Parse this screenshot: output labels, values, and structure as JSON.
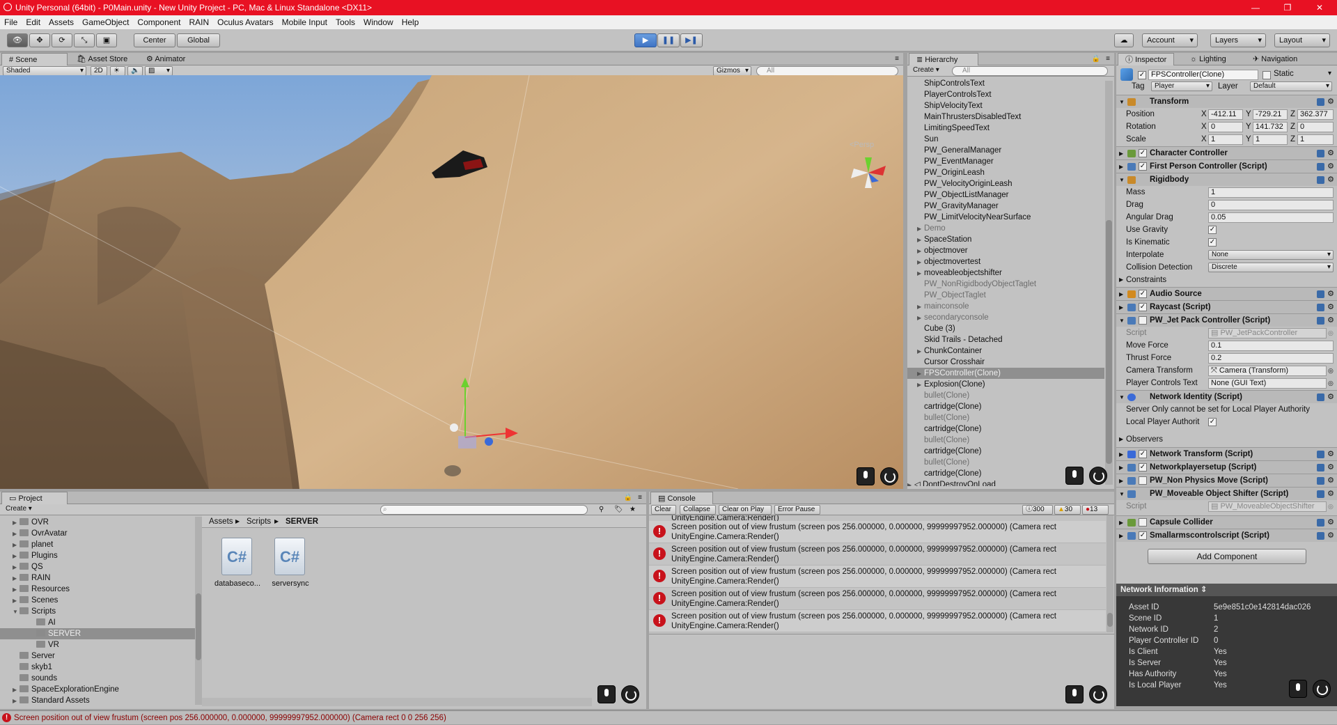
{
  "window": {
    "title": "Unity Personal (64bit) - P0Main.unity - New Unity Project - PC, Mac & Linux Standalone <DX11>"
  },
  "menu": [
    "File",
    "Edit",
    "Assets",
    "GameObject",
    "Component",
    "RAIN",
    "Oculus Avatars",
    "Mobile Input",
    "Tools",
    "Window",
    "Help"
  ],
  "toolbar": {
    "center": "Center",
    "global": "Global",
    "account": "Account",
    "layers": "Layers",
    "layout": "Layout"
  },
  "scene": {
    "tabs": [
      "Scene",
      "Asset Store",
      "Animator"
    ],
    "shading": "Shaded",
    "mode2d": "2D",
    "gizmos": "Gizmos",
    "search_placeholder": "All",
    "persp": "<Persp"
  },
  "hierarchy": {
    "tab": "Hierarchy",
    "create": "Create",
    "search_placeholder": "All",
    "items": [
      {
        "label": "ShipControlsText",
        "arrow": "",
        "style": "normal"
      },
      {
        "label": "PlayerControlsText",
        "arrow": "",
        "style": "normal"
      },
      {
        "label": "ShipVelocityText",
        "arrow": "",
        "style": "normal"
      },
      {
        "label": "MainThrustersDisabledText",
        "arrow": "",
        "style": "normal"
      },
      {
        "label": "LimitingSpeedText",
        "arrow": "",
        "style": "normal"
      },
      {
        "label": "Sun",
        "arrow": "",
        "style": "normal"
      },
      {
        "label": "PW_GeneralManager",
        "arrow": "",
        "style": "normal"
      },
      {
        "label": "PW_EventManager",
        "arrow": "",
        "style": "normal"
      },
      {
        "label": "PW_OriginLeash",
        "arrow": "",
        "style": "normal"
      },
      {
        "label": "PW_VelocityOriginLeash",
        "arrow": "",
        "style": "normal"
      },
      {
        "label": "PW_ObjectListManager",
        "arrow": "",
        "style": "normal"
      },
      {
        "label": "PW_GravityManager",
        "arrow": "",
        "style": "normal"
      },
      {
        "label": "PW_LimitVelocityNearSurface",
        "arrow": "",
        "style": "normal"
      },
      {
        "label": "Demo",
        "arrow": "▶",
        "style": "dim"
      },
      {
        "label": "SpaceStation",
        "arrow": "▶",
        "style": "normal"
      },
      {
        "label": "objectmover",
        "arrow": "▶",
        "style": "normal"
      },
      {
        "label": "objectmovertest",
        "arrow": "▶",
        "style": "normal"
      },
      {
        "label": "moveableobjectshifter",
        "arrow": "▶",
        "style": "normal"
      },
      {
        "label": "PW_NonRigidbodyObjectTaglet",
        "arrow": "",
        "style": "dim"
      },
      {
        "label": "PW_ObjectTaglet",
        "arrow": "",
        "style": "dim"
      },
      {
        "label": "mainconsole",
        "arrow": "▶",
        "style": "dim"
      },
      {
        "label": "secondaryconsole",
        "arrow": "▶",
        "style": "dim"
      },
      {
        "label": "Cube (3)",
        "arrow": "",
        "style": "normal"
      },
      {
        "label": "Skid Trails - Detached",
        "arrow": "",
        "style": "normal"
      },
      {
        "label": "ChunkContainer",
        "arrow": "▶",
        "style": "normal"
      },
      {
        "label": "Cursor Crosshair",
        "arrow": "",
        "style": "normal"
      },
      {
        "label": "FPSController(Clone)",
        "arrow": "▶",
        "style": "selected"
      },
      {
        "label": "Explosion(Clone)",
        "arrow": "▶",
        "style": "normal"
      },
      {
        "label": "bullet(Clone)",
        "arrow": "",
        "style": "dim"
      },
      {
        "label": "cartridge(Clone)",
        "arrow": "",
        "style": "normal"
      },
      {
        "label": "bullet(Clone)",
        "arrow": "",
        "style": "dim"
      },
      {
        "label": "cartridge(Clone)",
        "arrow": "",
        "style": "normal"
      },
      {
        "label": "bullet(Clone)",
        "arrow": "",
        "style": "dim"
      },
      {
        "label": "cartridge(Clone)",
        "arrow": "",
        "style": "normal"
      },
      {
        "label": "bullet(Clone)",
        "arrow": "",
        "style": "dim"
      },
      {
        "label": "cartridge(Clone)",
        "arrow": "",
        "style": "normal"
      }
    ],
    "footer": "DontDestroyOnLoad"
  },
  "inspector": {
    "tabs": [
      "Inspector",
      "Lighting",
      "Navigation"
    ],
    "object_name": "FPSController(Clone)",
    "static_label": "Static",
    "tag_label": "Tag",
    "tag": "Player",
    "layer_label": "Layer",
    "layer": "Default",
    "transform": {
      "title": "Transform",
      "position_label": "Position",
      "rotation_label": "Rotation",
      "scale_label": "Scale",
      "position": [
        "-412.11",
        "-729.21",
        "362.377"
      ],
      "rotation": [
        "0",
        "141.732",
        "0"
      ],
      "scale": [
        "1",
        "1",
        "1"
      ]
    },
    "character_controller": "Character Controller",
    "fps_controller": "First Person Controller (Script)",
    "rigidbody": {
      "title": "Rigidbody",
      "mass_label": "Mass",
      "mass": "1",
      "drag_label": "Drag",
      "drag": "0",
      "angular_drag_label": "Angular Drag",
      "angular_drag": "0.05",
      "use_gravity_label": "Use Gravity",
      "is_kinematic_label": "Is Kinematic",
      "interpolate_label": "Interpolate",
      "interpolate": "None",
      "collision_label": "Collision Detection",
      "collision": "Discrete",
      "constraints_label": "Constraints"
    },
    "audio_source": "Audio Source",
    "raycast": "Raycast (Script)",
    "jetpack": {
      "title": "PW_Jet Pack Controller (Script)",
      "script_label": "Script",
      "script": "PW_JetPackController",
      "move_force_label": "Move Force",
      "move_force": "0.1",
      "thrust_force_label": "Thrust Force",
      "thrust_force": "0.2",
      "camera_label": "Camera Transform",
      "camera": "Camera (Transform)",
      "player_text_label": "Player Controls Text",
      "player_text": "None (GUI Text)"
    },
    "network_identity": {
      "title": "Network Identity (Script)",
      "warning": "Server Only cannot be set for Local Player Authority",
      "local_player_label": "Local Player Authorit"
    },
    "observers": "Observers",
    "network_transform": "Network Transform (Script)",
    "networkplayersetup": "Networkplayersetup (Script)",
    "non_physics": "PW_Non Physics Move (Script)",
    "moveable": {
      "title": "PW_Moveable Object Shifter (Script)",
      "script_label": "Script",
      "script": "PW_MoveableObjectShifter"
    },
    "capsule": "Capsule Collider",
    "smallarms": "Smallarmscontrolscript (Script)",
    "add_component": "Add Component",
    "network_info": {
      "title": "Network Information",
      "rows": [
        {
          "k": "Asset ID",
          "v": "5e9e851c0e142814dac026"
        },
        {
          "k": "Scene ID",
          "v": "1"
        },
        {
          "k": "Network ID",
          "v": "2"
        },
        {
          "k": "Player Controller ID",
          "v": "0"
        },
        {
          "k": "Is Client",
          "v": "Yes"
        },
        {
          "k": "Is Server",
          "v": "Yes"
        },
        {
          "k": "Has Authority",
          "v": "Yes"
        },
        {
          "k": "Is Local Player",
          "v": "Yes"
        }
      ]
    }
  },
  "project": {
    "tab": "Project",
    "create": "Create",
    "folders": [
      {
        "label": "OVR",
        "indent": 1,
        "arrow": "▶"
      },
      {
        "label": "OvrAvatar",
        "indent": 1,
        "arrow": "▶"
      },
      {
        "label": "planet",
        "indent": 1,
        "arrow": "▶"
      },
      {
        "label": "Plugins",
        "indent": 1,
        "arrow": "▶"
      },
      {
        "label": "QS",
        "indent": 1,
        "arrow": "▶"
      },
      {
        "label": "RAIN",
        "indent": 1,
        "arrow": "▶"
      },
      {
        "label": "Resources",
        "indent": 1,
        "arrow": "▶"
      },
      {
        "label": "Scenes",
        "indent": 1,
        "arrow": "▶"
      },
      {
        "label": "Scripts",
        "indent": 1,
        "arrow": "▼"
      },
      {
        "label": "AI",
        "indent": 2,
        "arrow": ""
      },
      {
        "label": "SERVER",
        "indent": 2,
        "arrow": "",
        "selected": true
      },
      {
        "label": "VR",
        "indent": 2,
        "arrow": ""
      },
      {
        "label": "Server",
        "indent": 1,
        "arrow": ""
      },
      {
        "label": "skyb1",
        "indent": 1,
        "arrow": ""
      },
      {
        "label": "sounds",
        "indent": 1,
        "arrow": ""
      },
      {
        "label": "SpaceExplorationEngine",
        "indent": 1,
        "arrow": "▶"
      },
      {
        "label": "Standard Assets",
        "indent": 1,
        "arrow": "▶"
      }
    ],
    "breadcrumb": [
      "Assets",
      "Scripts",
      "SERVER"
    ],
    "files": [
      {
        "name": "databaseco...",
        "icon": "C#"
      },
      {
        "name": "serversync",
        "icon": "C#"
      }
    ]
  },
  "console": {
    "tab": "Console",
    "buttons": [
      "Clear",
      "Collapse",
      "Clear on Play",
      "Error Pause"
    ],
    "counts": {
      "log": "300",
      "warn": "30",
      "error": "13"
    },
    "top_line": "UnityEngine.Camera:Render()",
    "messages": [
      {
        "line1": "Screen position out of view frustum (screen pos 256.000000, 0.000000, 99999997952.000000) (Camera rect",
        "line2": "UnityEngine.Camera:Render()"
      },
      {
        "line1": "Screen position out of view frustum (screen pos 256.000000, 0.000000, 99999997952.000000) (Camera rect",
        "line2": "UnityEngine.Camera:Render()"
      },
      {
        "line1": "Screen position out of view frustum (screen pos 256.000000, 0.000000, 99999997952.000000) (Camera rect",
        "line2": "UnityEngine.Camera:Render()"
      },
      {
        "line1": "Screen position out of view frustum (screen pos 256.000000, 0.000000, 99999997952.000000) (Camera rect",
        "line2": "UnityEngine.Camera:Render()"
      },
      {
        "line1": "Screen position out of view frustum (screen pos 256.000000, 0.000000, 99999997952.000000) (Camera rect",
        "line2": "UnityEngine.Camera:Render()"
      }
    ]
  },
  "status": {
    "text": "Screen position out of view frustum (screen pos 256.000000, 0.000000, 99999997952.000000) (Camera rect 0 0 256 256)"
  }
}
